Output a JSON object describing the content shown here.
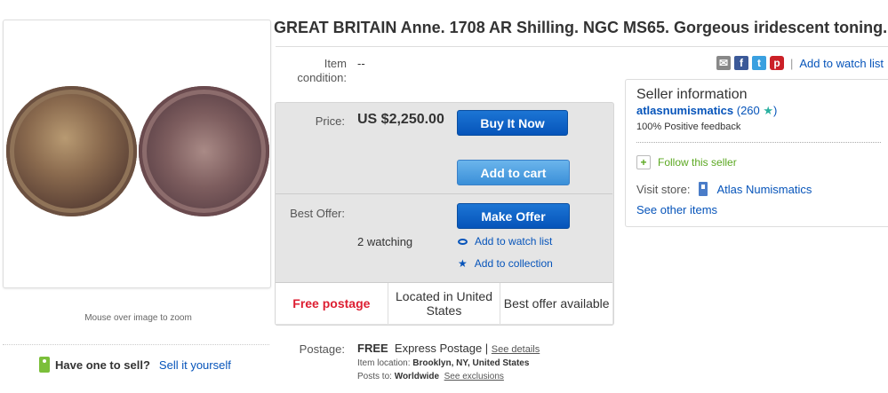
{
  "title": "GREAT BRITAIN Anne. 1708 AR Shilling. NGC MS65. Gorgeous iridescent toning.",
  "condition": {
    "label": "Item condition:",
    "value": "--"
  },
  "share": {
    "icons": [
      "mail-icon",
      "facebook-icon",
      "twitter-icon",
      "pinterest-icon"
    ],
    "fb_glyph": "f",
    "tw_glyph": "t",
    "pin_glyph": "p",
    "watch_label": "Add to watch list"
  },
  "image": {
    "zoom_hint": "Mouse over image to zoom"
  },
  "sell": {
    "prompt": "Have one to sell?",
    "link": "Sell it yourself"
  },
  "price": {
    "label": "Price:",
    "value": "US $2,250.00",
    "buy_now": "Buy It Now",
    "add_to_cart": "Add to cart"
  },
  "best_offer": {
    "label": "Best Offer:",
    "button": "Make Offer",
    "watching": "2 watching",
    "watch_link": "Add to watch list",
    "collection_link": "Add to collection"
  },
  "info_row": [
    {
      "text": "Free postage"
    },
    {
      "text": "Located in United States"
    },
    {
      "text": "Best offer available"
    }
  ],
  "postage": {
    "label": "Postage:",
    "free": "FREE",
    "service": "Express Postage |",
    "details_link": "See details",
    "location_label": "Item location:",
    "location_value": "Brooklyn, NY, United States",
    "posts_to_label": "Posts to:",
    "posts_to_value": "Worldwide",
    "exclusions_link": "See exclusions"
  },
  "seller": {
    "heading": "Seller information",
    "name": "atlasnumismatics",
    "score": "(260",
    "feedback": "100% Positive feedback",
    "follow": "Follow this seller",
    "visit_label": "Visit store:",
    "store_name": "Atlas Numismatics",
    "see_other": "See other items"
  },
  "colors": {
    "link": "#0654ba",
    "buy_button": "#0654ba",
    "free_postage": "#dd1e31",
    "follow_green": "#5ba821"
  }
}
